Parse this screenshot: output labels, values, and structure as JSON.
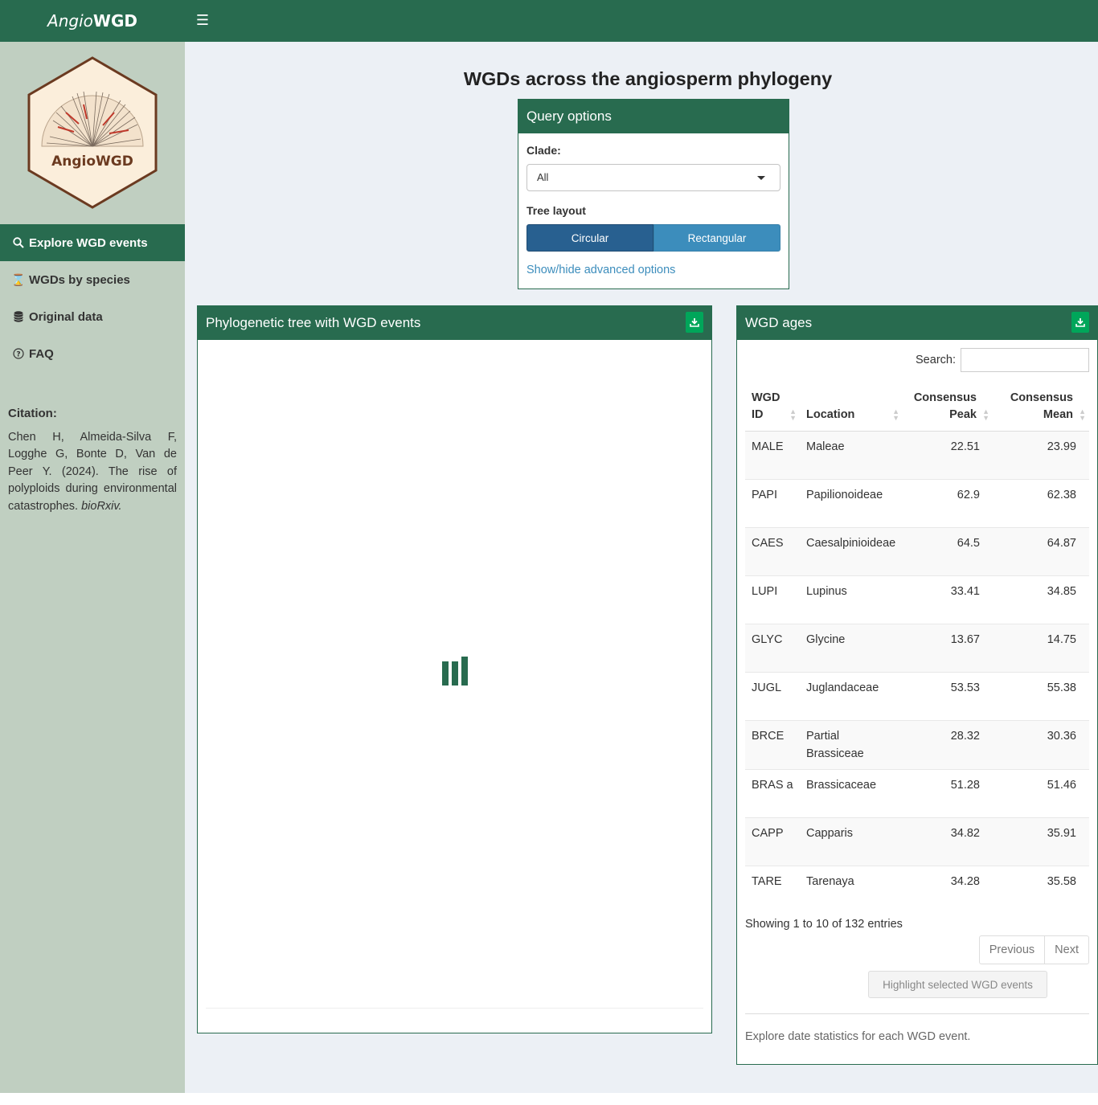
{
  "header": {
    "brand_italic": "Angio",
    "brand_bold": "WGD",
    "menu_icon": "hamburger-icon"
  },
  "sidebar": {
    "logo_text": "AngioWGD",
    "items": [
      {
        "label": "Explore WGD events",
        "icon": "search-icon",
        "active": true
      },
      {
        "label": "WGDs by species",
        "icon": "hourglass-icon",
        "active": false
      },
      {
        "label": "Original data",
        "icon": "database-icon",
        "active": false
      },
      {
        "label": "FAQ",
        "icon": "question-circle-icon",
        "active": false
      }
    ],
    "citation_title": "Citation:",
    "citation_text": "Chen H, Almeida-Silva F, Logghe G, Bonte D, Van de Peer Y. (2024). The rise of polyploids during environmental catastrophes.",
    "citation_journal": "bioRxiv."
  },
  "main": {
    "title": "WGDs across the angiosperm phylogeny",
    "query": {
      "title": "Query options",
      "clade_label": "Clade:",
      "clade_value": "All",
      "layout_label": "Tree layout",
      "layout_options": [
        "Circular",
        "Rectangular"
      ],
      "layout_selected": "Circular",
      "advanced_link": "Show/hide advanced options"
    },
    "tree_box": {
      "title": "Phylogenetic tree with WGD events",
      "download_icon": "download-icon"
    },
    "ages_box": {
      "title": "WGD ages",
      "download_icon": "download-icon",
      "search_label": "Search:",
      "search_value": "",
      "columns": [
        "WGD ID",
        "Location",
        "Consensus Peak",
        "Consensus Mean"
      ],
      "rows": [
        [
          "MALE",
          "Maleae",
          "22.51",
          "23.99"
        ],
        [
          "PAPI",
          "Papilionoideae",
          "62.9",
          "62.38"
        ],
        [
          "CAES",
          "Caesalpinioideae",
          "64.5",
          "64.87"
        ],
        [
          "LUPI",
          "Lupinus",
          "33.41",
          "34.85"
        ],
        [
          "GLYC",
          "Glycine",
          "13.67",
          "14.75"
        ],
        [
          "JUGL",
          "Juglandaceae",
          "53.53",
          "55.38"
        ],
        [
          "BRCE",
          "Partial Brassiceae",
          "28.32",
          "30.36"
        ],
        [
          "BRAS a",
          "Brassicaceae",
          "51.28",
          "51.46"
        ],
        [
          "CAPP",
          "Capparis",
          "34.82",
          "35.91"
        ],
        [
          "TARE",
          "Tarenaya",
          "34.28",
          "35.58"
        ]
      ],
      "info": "Showing 1 to 10 of 132 entries",
      "prev_label": "Previous",
      "next_label": "Next",
      "highlight_label": "Highlight selected WGD events",
      "footer": "Explore date statistics for each WGD event."
    }
  },
  "colors": {
    "brand_green": "#286b4f",
    "sidebar_bg": "#c0cfc1",
    "content_bg": "#ecf0f5",
    "download_green": "#00a65a",
    "link_blue": "#3c8dbc"
  }
}
